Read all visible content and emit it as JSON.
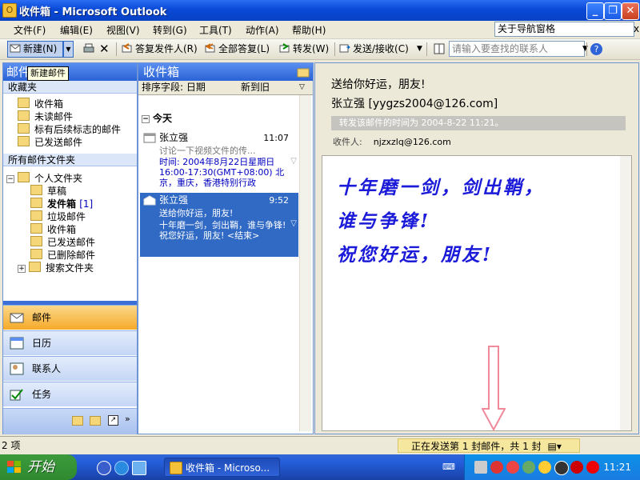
{
  "window": {
    "title": "收件箱 - Microsoft Outlook",
    "icon": "outlook-icon"
  },
  "menu": {
    "items": [
      "文件(F)",
      "编辑(E)",
      "视图(V)",
      "转到(G)",
      "工具(T)",
      "动作(A)",
      "帮助(H)"
    ],
    "help_box": "关于导航窗格",
    "close_glyph": "x"
  },
  "toolbar": {
    "new_label": "新建(N)",
    "reply_label": "答复发件人(R)",
    "reply_all_label": "全部答复(L)",
    "forward_label": "转发(W)",
    "send_receive_label": "发送/接收(C)",
    "contact_placeholder": "请输入要查找的联系人",
    "tooltip": "新建邮件"
  },
  "nav": {
    "header": "邮件",
    "favorites_header": "收藏夹",
    "favorites": [
      "收件箱",
      "未读邮件",
      "标有后续标志的邮件",
      "已发送邮件"
    ],
    "all_folders_header": "所有邮件文件夹",
    "root": "个人文件夹",
    "folders": [
      "草稿",
      "发件箱",
      "垃圾邮件",
      "收件箱",
      "已发送邮件",
      "已删除邮件",
      "搜索文件夹"
    ],
    "outbox_count": "[1]",
    "buttons": [
      "邮件",
      "日历",
      "联系人",
      "任务"
    ]
  },
  "list": {
    "header": "收件箱",
    "sort_field": "排序字段: 日期",
    "sort_order": "新到旧",
    "group": "今天",
    "messages": [
      {
        "from": "张立强",
        "time": "11:07",
        "subject": "讨论一下视频文件的传...",
        "body": "时间: 2004年8月22日星期日 16:00-17:30(GMT+08:00) 北京，重庆，香港特别行政",
        "selected": false
      },
      {
        "from": "张立强",
        "time": "9:52",
        "subject": "送给你好运，朋友!",
        "body": "十年磨一剑，剑出鞘，谁与争锋!\n祝您好运，朋友! <结束>",
        "selected": true
      }
    ]
  },
  "reader": {
    "subject": "送给你好运，朋友!",
    "sender": "张立强 [yygzs2004@126.com]",
    "forward_note": "转发该邮件的时间为 2004-8-22 11:21。",
    "to_label": "收件人:",
    "to_value": "njzxzlq@126.com",
    "body_lines": [
      "十年磨一剑，剑出鞘，",
      "谁与争锋!",
      "祝您好运，朋友!"
    ]
  },
  "status": {
    "items": "2 项",
    "sending": "正在发送第 1 封邮件，共 1 封"
  },
  "taskbar": {
    "start": "开始",
    "window_item": "收件箱 - Microso...",
    "clock": "11:21"
  },
  "colors": {
    "title_bar": "#0a49d6",
    "selection": "#316ac5",
    "body_text": "#1a1ad8",
    "active_nav": "#f5a929"
  }
}
